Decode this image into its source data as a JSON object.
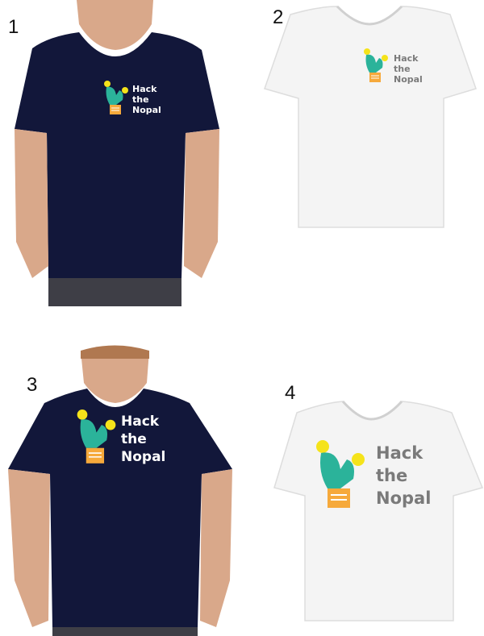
{
  "panels": [
    {
      "number": "1",
      "shirt": "navy",
      "model": true,
      "logo": {
        "line1": "Hack",
        "line2": "the",
        "line3": "Nopal"
      }
    },
    {
      "number": "2",
      "shirt": "white",
      "model": false,
      "logo": {
        "line1": "Hack",
        "line2": "the",
        "line3": "Nopal"
      }
    },
    {
      "number": "3",
      "shirt": "navy",
      "model": true,
      "logo": {
        "line1": "Hack",
        "line2": "the",
        "line3": "Nopal"
      }
    },
    {
      "number": "4",
      "shirt": "white",
      "model": false,
      "logo": {
        "line1": "Hack",
        "line2": "the",
        "line3": "Nopal"
      }
    }
  ],
  "colors": {
    "navy": "#12173a",
    "white_shirt": "#f4f4f4",
    "skin": "#d9a88a",
    "cactus": "#2bb39a",
    "pot": "#f6a93b",
    "flower": "#f5e31a",
    "logo_text_on_navy": "#ffffff",
    "logo_text_on_white": "#7a7a7a"
  },
  "icons": [
    "cactus-logo-icon",
    "flower-icon",
    "pot-icon"
  ]
}
